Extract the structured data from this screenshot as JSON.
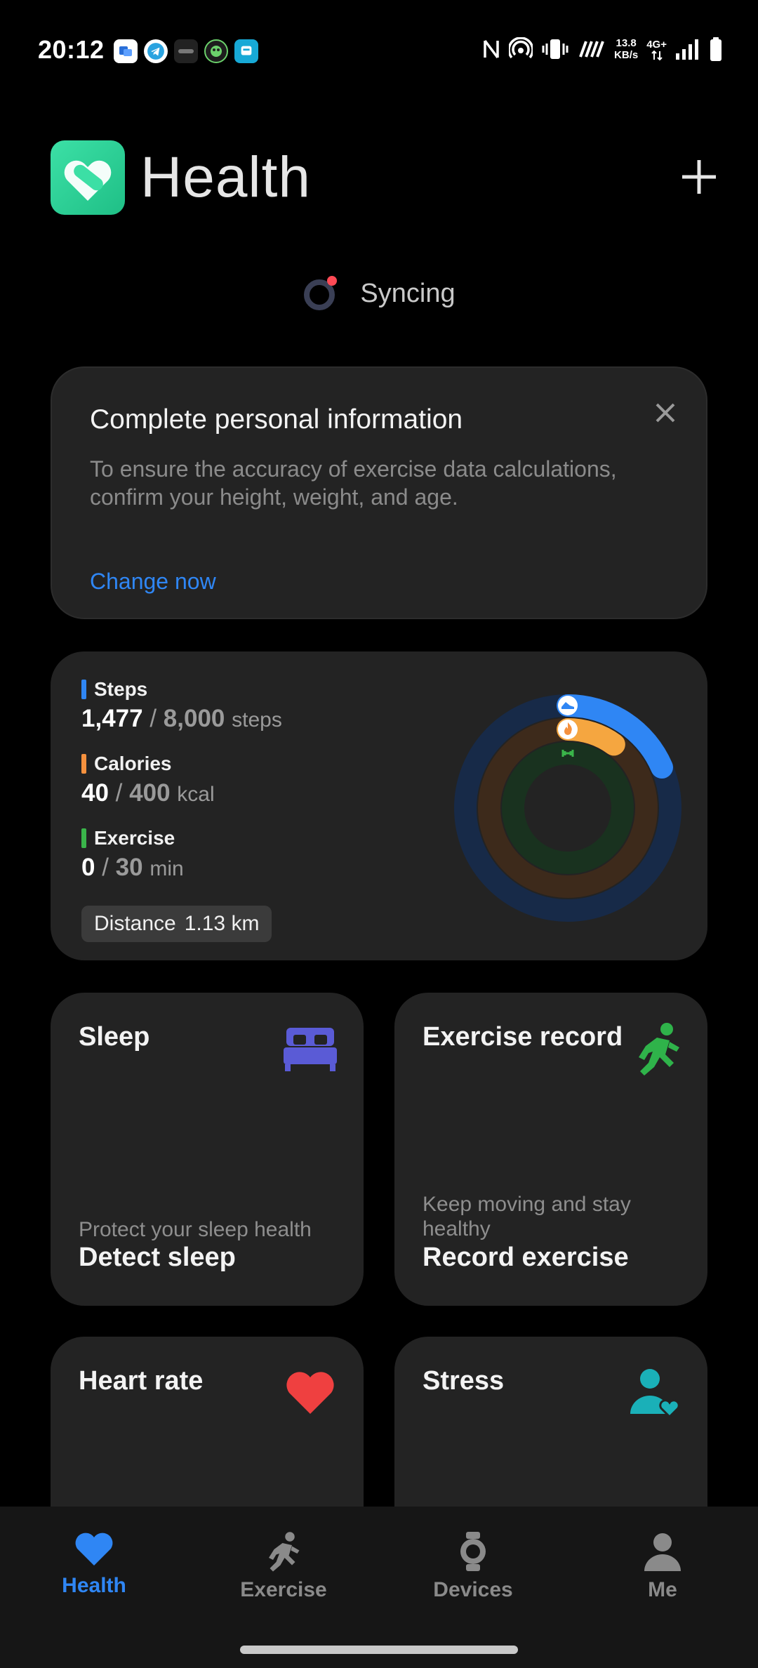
{
  "status_bar": {
    "time": "20:12",
    "speed_value": "13.8",
    "speed_unit": "KB/s",
    "network": "4G+",
    "notification_icons": [
      "photos-icon",
      "telegram-icon",
      "app-icon",
      "game-icon",
      "app-icon"
    ]
  },
  "header": {
    "title": "Health",
    "add_button": "plus-icon"
  },
  "sync": {
    "label": "Syncing"
  },
  "info_card": {
    "title": "Complete personal information",
    "description": "To ensure the accuracy of exercise data calculations, confirm your height, weight, and age.",
    "link": "Change now"
  },
  "activity": {
    "steps": {
      "label": "Steps",
      "current": "1,477",
      "separator": "/",
      "target": "8,000",
      "unit": "steps",
      "color": "#2f86f4",
      "progress": 0.185
    },
    "calories": {
      "label": "Calories",
      "current": "40",
      "separator": "/",
      "target": "400",
      "unit": "kcal",
      "color": "#f5913e",
      "progress": 0.1
    },
    "exercise": {
      "label": "Exercise",
      "current": "0",
      "separator": "/",
      "target": "30",
      "unit": "min",
      "color": "#3ab54a",
      "progress": 0
    },
    "distance": {
      "label": "Distance",
      "value": "1.13 km"
    }
  },
  "tiles": {
    "sleep": {
      "title": "Sleep",
      "subtitle": "Protect your sleep health",
      "main": "Detect sleep",
      "icon": "bed-icon",
      "icon_color": "#5a5bd6"
    },
    "exercise_record": {
      "title": "Exercise record",
      "subtitle": "Keep moving and stay healthy",
      "main": "Record exercise",
      "icon": "running-icon",
      "icon_color": "#2fb34a"
    },
    "heart_rate": {
      "title": "Heart rate",
      "icon": "heart-icon",
      "icon_color": "#ef4040"
    },
    "stress": {
      "title": "Stress",
      "icon": "person-heart-icon",
      "icon_color": "#1ab0b8"
    }
  },
  "bottom_nav": {
    "items": [
      {
        "label": "Health",
        "icon": "heart-icon",
        "active": true
      },
      {
        "label": "Exercise",
        "icon": "running-icon",
        "active": false
      },
      {
        "label": "Devices",
        "icon": "watch-icon",
        "active": false
      },
      {
        "label": "Me",
        "icon": "person-icon",
        "active": false
      }
    ]
  },
  "colors": {
    "accent": "#2f86f4",
    "card": "#232323",
    "background": "#000000"
  }
}
